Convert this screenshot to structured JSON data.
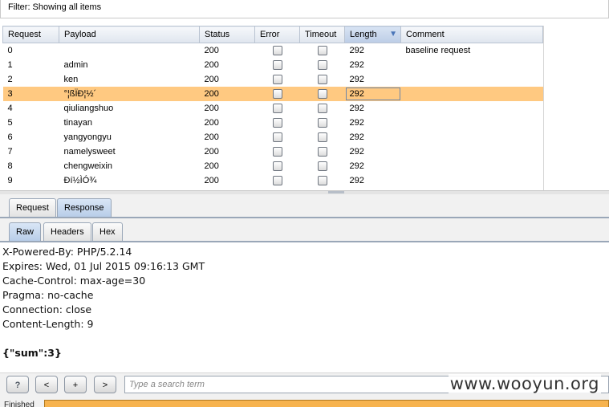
{
  "filter": {
    "text": "Filter: Showing all items"
  },
  "table": {
    "columns": [
      "Request",
      "Payload",
      "Status",
      "Error",
      "Timeout",
      "Length",
      "Comment"
    ],
    "sorted_column": "Length",
    "rows": [
      {
        "request": "0",
        "payload": "",
        "status": "200",
        "error": false,
        "timeout": false,
        "length": "292",
        "comment": "baseline request"
      },
      {
        "request": "1",
        "payload": "admin",
        "status": "200",
        "error": false,
        "timeout": false,
        "length": "292",
        "comment": ""
      },
      {
        "request": "2",
        "payload": "ken",
        "status": "200",
        "error": false,
        "timeout": false,
        "length": "292",
        "comment": ""
      },
      {
        "request": "3",
        "payload": "°¦ßÏÐ¦½´",
        "status": "200",
        "error": false,
        "timeout": false,
        "length": "292",
        "comment": "",
        "selected": true
      },
      {
        "request": "4",
        "payload": "qiuliangshuo",
        "status": "200",
        "error": false,
        "timeout": false,
        "length": "292",
        "comment": ""
      },
      {
        "request": "5",
        "payload": "tinayan",
        "status": "200",
        "error": false,
        "timeout": false,
        "length": "292",
        "comment": ""
      },
      {
        "request": "6",
        "payload": "yangyongyu",
        "status": "200",
        "error": false,
        "timeout": false,
        "length": "292",
        "comment": ""
      },
      {
        "request": "7",
        "payload": "namelysweet",
        "status": "200",
        "error": false,
        "timeout": false,
        "length": "292",
        "comment": ""
      },
      {
        "request": "8",
        "payload": "chengweixin",
        "status": "200",
        "error": false,
        "timeout": false,
        "length": "292",
        "comment": ""
      },
      {
        "request": "9",
        "payload": "Ðí½ÌÓ¾",
        "status": "200",
        "error": false,
        "timeout": false,
        "length": "292",
        "comment": ""
      }
    ]
  },
  "message_tabs": [
    {
      "label": "Request",
      "active": false
    },
    {
      "label": "Response",
      "active": true
    }
  ],
  "view_tabs": [
    {
      "label": "Raw",
      "active": true
    },
    {
      "label": "Headers",
      "active": false
    },
    {
      "label": "Hex",
      "active": false
    }
  ],
  "response": {
    "headers": [
      "X-Powered-By: PHP/5.2.14",
      "Expires: Wed, 01 Jul 2015 09:16:13 GMT",
      "Cache-Control: max-age=30",
      "Pragma: no-cache",
      "Connection: close",
      "Content-Length: 9"
    ],
    "body": "{\"sum\":3}"
  },
  "search": {
    "help_label": "?",
    "prev_label": "<",
    "add_label": "+",
    "next_label": ">",
    "placeholder": "Type a search term"
  },
  "watermark": "www.wooyun.org",
  "status": {
    "label": "Finished",
    "progress": 1.0
  },
  "colors": {
    "selected_row": "#ffc981",
    "progress": "#f7b34e"
  }
}
